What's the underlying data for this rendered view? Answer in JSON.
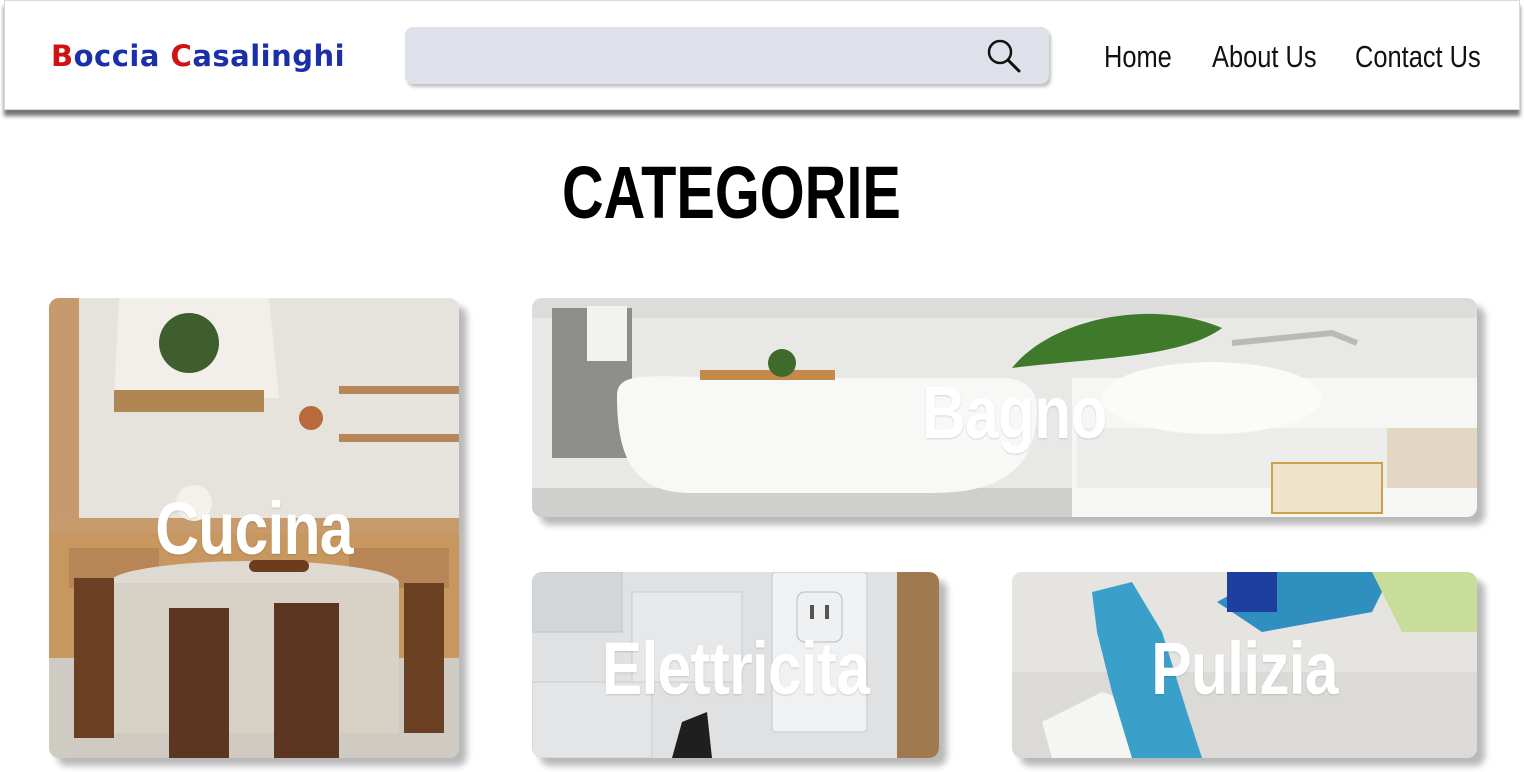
{
  "header": {
    "logo": {
      "first_initial": "B",
      "first_rest": "occia",
      "second_initial": "C",
      "second_rest": "asalinghi"
    },
    "search": {
      "placeholder": "",
      "icon": "search-icon"
    },
    "nav": [
      {
        "label": "Home"
      },
      {
        "label": "About Us"
      },
      {
        "label": "Contact Us"
      }
    ]
  },
  "page": {
    "title": "CATEGORIE"
  },
  "categories": [
    {
      "label": "Cucina",
      "image": "kitchen-photo"
    },
    {
      "label": "Bagno",
      "image": "bathroom-photo"
    },
    {
      "label": "Elettricita",
      "image": "electrical-outlet-photo"
    },
    {
      "label": "Pulizia",
      "image": "cleaning-gloves-photo"
    }
  ],
  "colors": {
    "logo_red": "#d01212",
    "logo_blue": "#1b2fa8",
    "search_bg": "#dfe1ea",
    "text": "#111111",
    "card_text": "#ffffff"
  }
}
